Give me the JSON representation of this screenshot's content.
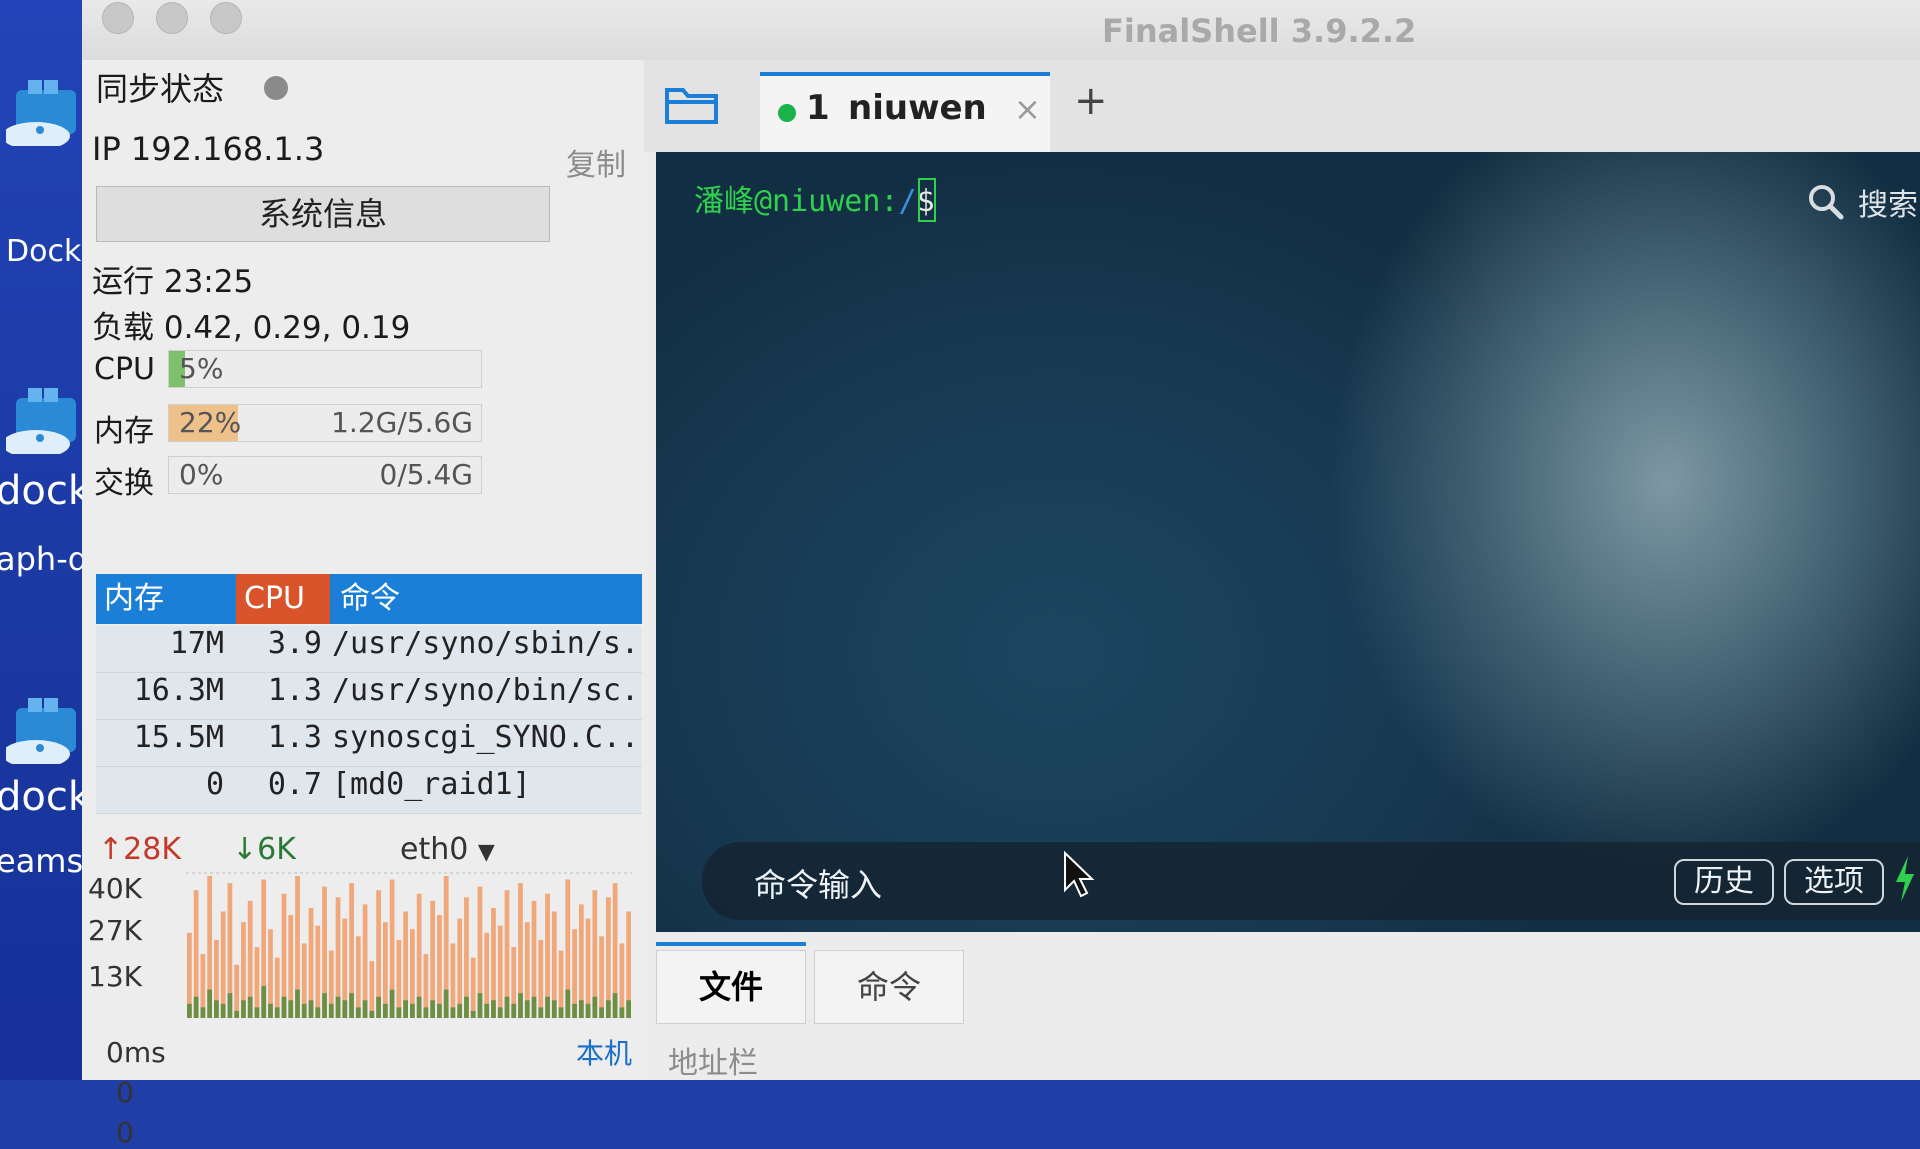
{
  "app": {
    "title": "FinalShell 3.9.2.2"
  },
  "desktop": {
    "labels": [
      "Dock",
      "dock",
      "aph-d",
      "dock",
      "eams"
    ]
  },
  "sidebar": {
    "sync_label": "同步状态",
    "ip_text": "IP 192.168.1.3",
    "copy_label": "复制",
    "sysinfo_button": "系统信息",
    "uptime": "运行 23:25",
    "load": "负载 0.42, 0.29, 0.19",
    "cpu": {
      "label": "CPU",
      "percent_text": "5%",
      "percent": 5
    },
    "memory": {
      "label": "内存",
      "percent_text": "22%",
      "percent": 22,
      "usage": "1.2G/5.6G"
    },
    "swap": {
      "label": "交换",
      "percent_text": "0%",
      "percent": 0,
      "usage": "0/5.4G"
    },
    "process_table": {
      "headers": [
        "内存",
        "CPU",
        "命令"
      ],
      "rows": [
        {
          "mem": "17M",
          "cpu": "3.9",
          "cmd": "/usr/syno/sbin/s..."
        },
        {
          "mem": "16.3M",
          "cpu": "1.3",
          "cmd": "/usr/syno/bin/sc..."
        },
        {
          "mem": "15.5M",
          "cpu": "1.3",
          "cmd": "synoscgi_SYNO.C..."
        },
        {
          "mem": "0",
          "cpu": "0.7",
          "cmd": "[md0_raid1]"
        }
      ]
    },
    "network": {
      "upload": "28K",
      "download": "6K",
      "interface": "eth0",
      "y_labels": [
        "40K",
        "27K",
        "13K"
      ]
    },
    "ping": {
      "latency": "0ms",
      "host_label": "本机",
      "values": [
        "0",
        "0"
      ]
    }
  },
  "tabs": {
    "items": [
      {
        "index": "1",
        "name": "niuwen",
        "status_color": "#19b34a"
      }
    ],
    "add_symbol": "+"
  },
  "terminal": {
    "prompt_user": "潘峰@niuwen:",
    "prompt_path": "/",
    "prompt_symbol": "$",
    "search_label": "搜索",
    "command_placeholder": "命令输入",
    "history_button": "历史",
    "options_button": "选项"
  },
  "bottom": {
    "tabs": [
      "文件",
      "命令"
    ],
    "address_label": "地址栏"
  },
  "colors": {
    "accent": "#1b7fd8",
    "cpu_header": "#d9542b",
    "prompt_green": "#2fd04d",
    "path_blue": "#3b8fe0",
    "upload_red": "#d23a2a",
    "download_green": "#2a8a3a",
    "traffic_orange": "#f0a77a"
  },
  "chart_data": {
    "type": "bar",
    "title": "",
    "ylabel": "",
    "ylim": [
      0,
      40000
    ],
    "series": [
      {
        "values": [
          24000,
          36000,
          18000,
          40000,
          22000,
          30000,
          38000,
          15000,
          27000,
          33000,
          20000,
          39000,
          25000,
          17000,
          35000,
          29000,
          40000,
          21000,
          31000,
          26000,
          37000,
          19000,
          34000,
          28000,
          38000,
          23000,
          32000,
          16000,
          36000,
          27000,
          39000,
          22000,
          30000,
          25000,
          35000,
          18000,
          33000,
          29000,
          40000,
          21000,
          28000,
          34000,
          17000,
          37000,
          24000,
          31000,
          26000,
          36000,
          20000,
          38000,
          27000,
          33000,
          22000,
          35000,
          30000,
          19000,
          39000,
          25000,
          32000,
          28000,
          36000,
          23000,
          34000,
          38000,
          21000,
          30000
        ]
      },
      {
        "values": [
          4000,
          6000,
          3000,
          8000,
          5000,
          4000,
          7000,
          2000,
          5000,
          6000,
          3000,
          9000,
          4000,
          3000,
          6000,
          5000,
          8000,
          4000,
          5000,
          3000,
          7000,
          4000,
          6000,
          5000,
          7000,
          3000,
          5000,
          2000,
          6000,
          4000,
          8000,
          3000,
          5000,
          4000,
          6000,
          3000,
          5000,
          4000,
          8000,
          3000,
          4000,
          6000,
          2000,
          7000,
          4000,
          5000,
          3000,
          6000,
          4000,
          7000,
          5000,
          6000,
          3000,
          6000,
          5000,
          3000,
          8000,
          4000,
          5000,
          4000,
          6000,
          3000,
          5000,
          7000,
          3000,
          5000
        ]
      }
    ]
  }
}
